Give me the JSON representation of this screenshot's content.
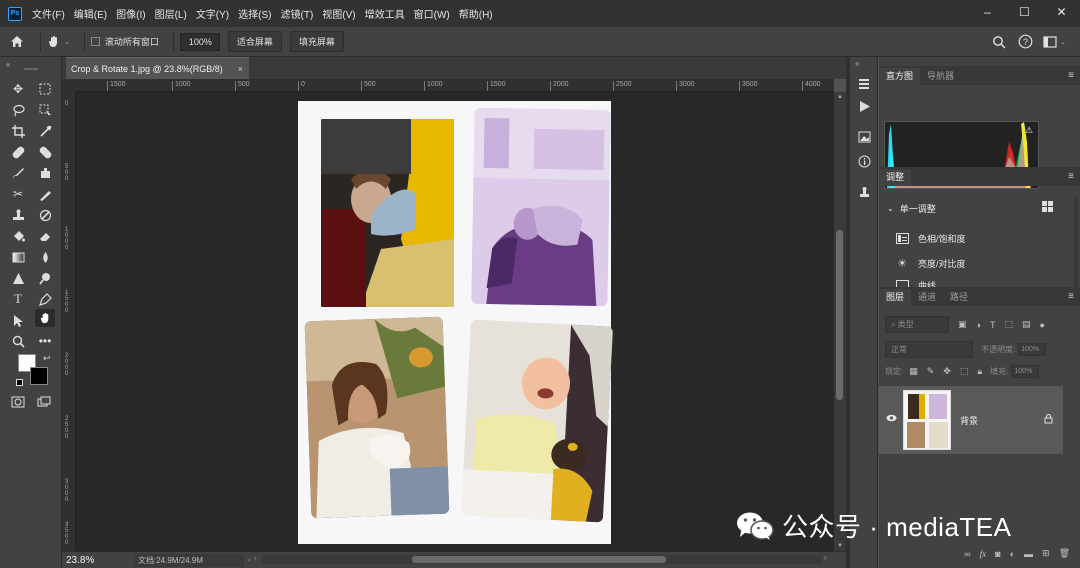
{
  "menubar": {
    "logo": "Ps",
    "items": [
      "文件(F)",
      "编辑(E)",
      "图像(I)",
      "图层(L)",
      "文字(Y)",
      "选择(S)",
      "滤镜(T)",
      "视图(V)",
      "增效工具",
      "窗口(W)",
      "帮助(H)"
    ],
    "window_controls": [
      "–",
      "☐",
      "✕"
    ]
  },
  "options": {
    "scroll_all_label": "滚动所有窗口",
    "zoom_value": "100%",
    "fit_screen_label": "适合屏幕",
    "fill_screen_label": "填充屏幕"
  },
  "document": {
    "tab_title": "Crop & Rotate 1.jpg @ 23.8%(RGB/8)",
    "tab_close": "×",
    "zoom_status": "23.8%",
    "doc_size": "文档:24.9M/24.9M"
  },
  "ruler": {
    "h_ticks": [
      "1500",
      "1000",
      "500",
      "0",
      "500",
      "1000",
      "1500",
      "2000",
      "2500",
      "3000",
      "3500",
      "4000"
    ],
    "v_ticks": [
      "0",
      "500",
      "1000",
      "1500",
      "2000",
      "2500",
      "3000",
      "3500"
    ]
  },
  "panels": {
    "top_tabs": [
      "直方图",
      "导航器"
    ],
    "adjust_tab": "调整",
    "adjust_group": "单一调整",
    "adjust_items": [
      "色相/饱和度",
      "亮度/对比度",
      "曲线"
    ],
    "layer_tabs": [
      "图层",
      "通道",
      "路径"
    ],
    "layer_search": "类型",
    "blend_mode": "正常",
    "opacity_label": "不透明度:",
    "opacity_value": "100%",
    "lock_label": "锁定:",
    "fill_label": "填充:",
    "fill_value": "100%",
    "layer_name": "背景"
  },
  "watermark": {
    "text": "公众号 · mediaTEA"
  },
  "colors": {
    "app_bg": "#535353",
    "canvas_bg": "#282828",
    "menubar_bg": "#323232",
    "panel_bg": "#424242",
    "accent": "#31a8ff"
  }
}
